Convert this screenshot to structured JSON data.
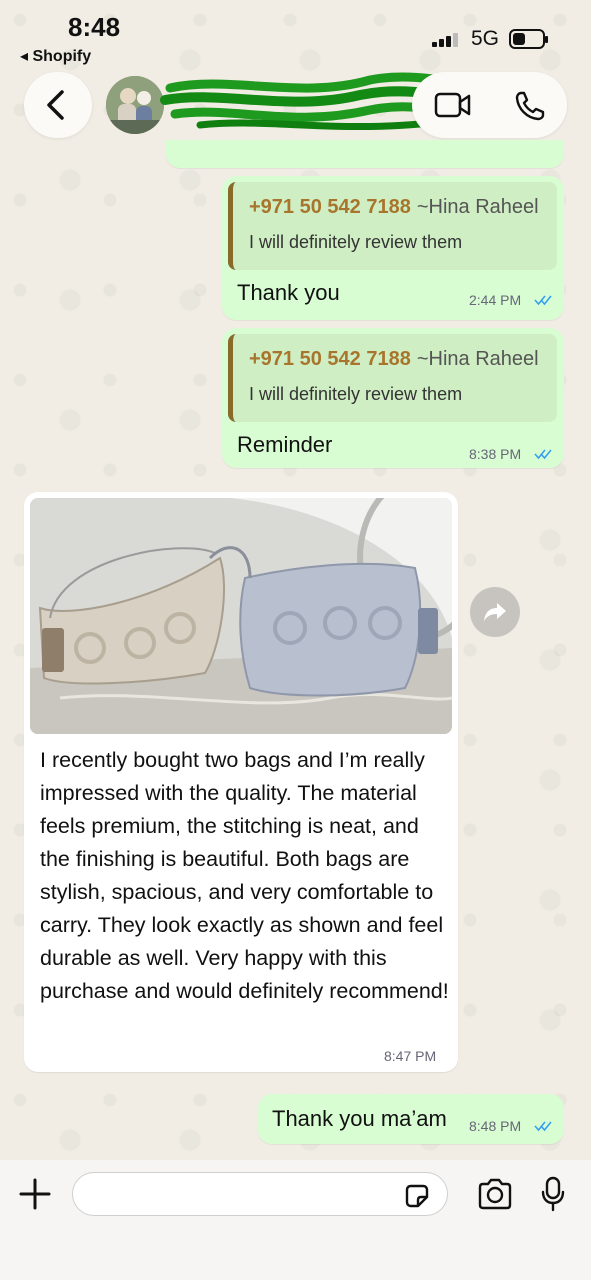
{
  "status_bar": {
    "time": "8:48",
    "back_app": "◂ Shopify",
    "network": "5G"
  },
  "header": {
    "contact_name": "Hina Raheel (redacted)",
    "icons": [
      "back-chevron-icon",
      "video-call-icon",
      "phone-icon"
    ]
  },
  "messages": [
    {
      "direction": "outgoing",
      "quote_sender": "+971 50 542 7188",
      "quote_alias": "~Hina Raheel",
      "quote_text": "I will definitely review them",
      "text": "Thank you",
      "time": "2:44 PM",
      "read": true
    },
    {
      "direction": "outgoing",
      "quote_sender": "+971 50 542 7188",
      "quote_alias": "~Hina Raheel",
      "quote_text": "I will definitely review them",
      "text": "Reminder",
      "time": "8:38 PM",
      "read": true
    },
    {
      "direction": "incoming",
      "has_photo": true,
      "text": "I recently bought two bags and I’m really impressed with the quality. The material feels premium, the stitching is neat, and the finishing is beautiful. Both bags are stylish, spacious, and very comfortable to carry. They look exactly as shown and feel durable as well. Very happy with this purchase and would definitely recommend!",
      "time": "8:47 PM"
    },
    {
      "direction": "outgoing",
      "text": "Thank you ma’am",
      "time": "8:48 PM",
      "read": true
    }
  ],
  "input": {
    "placeholder": ""
  },
  "colors": {
    "outgoing_bubble": "#d9fdd3",
    "incoming_bubble": "#ffffff",
    "read_ticks": "#34b7f1",
    "quote_sender": "#a7762c"
  }
}
